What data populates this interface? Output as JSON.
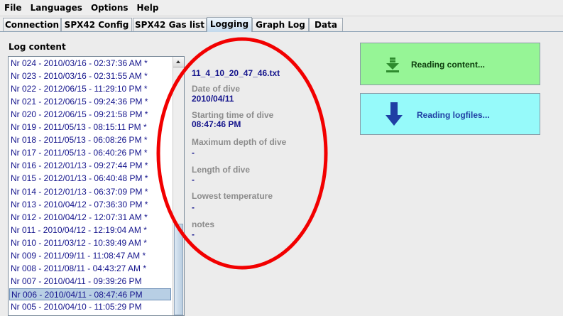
{
  "menubar": {
    "items": [
      {
        "label": "File"
      },
      {
        "label": "Languages"
      },
      {
        "label": "Options"
      },
      {
        "label": "Help"
      }
    ]
  },
  "tabs": [
    {
      "label": "Connection"
    },
    {
      "label": "SPX42 Config"
    },
    {
      "label": "SPX42 Gas list"
    },
    {
      "label": "Logging",
      "active": true
    },
    {
      "label": "Graph Log"
    },
    {
      "label": "Data"
    }
  ],
  "log": {
    "title": "Log content",
    "items": [
      "Nr  024 - 2010/03/16 - 02:37:36 AM *",
      "Nr  023 - 2010/03/16 - 02:31:55 AM *",
      "Nr  022 - 2012/06/15 - 11:29:10 PM *",
      "Nr  021 - 2012/06/15 - 09:24:36 PM *",
      "Nr  020 - 2012/06/15 - 09:21:58 PM *",
      "Nr  019 - 2011/05/13 - 08:15:11 PM *",
      "Nr  018 - 2011/05/13 - 06:08:26 PM *",
      "Nr  017 - 2011/05/13 - 06:40:26 PM *",
      "Nr  016 - 2012/01/13 - 09:27:44 PM *",
      "Nr  015 - 2012/01/13 - 06:40:48 PM *",
      "Nr  014 - 2012/01/13 - 06:37:09 PM *",
      "Nr  013 - 2010/04/12 - 07:36:30 PM *",
      "Nr  012 - 2010/04/12 - 12:07:31 AM *",
      "Nr  011 - 2010/04/12 - 12:19:04 AM *",
      "Nr  010 - 2011/03/12 - 10:39:49 AM *",
      "Nr  009 - 2011/09/11 - 11:08:47 AM *",
      "Nr  008 - 2011/08/11 - 04:43:27 AM *",
      "Nr  007 - 2010/04/11 - 09:39:26 PM",
      "Nr  006 - 2010/04/11 - 08:47:46 PM",
      "Nr  005 - 2010/04/10 - 11:05:29 PM"
    ],
    "selected_index": 18
  },
  "details": {
    "filename": "11_4_10_20_47_46.txt",
    "date_label": "Date of dive",
    "date_value": "2010/04/11",
    "start_label": "Starting time of dive",
    "start_value": "08:47:46 PM",
    "depth_label": "Maximum depth of dive",
    "depth_value": "-",
    "length_label": "Length of dive",
    "length_value": "-",
    "temp_label": "Lowest temperature",
    "temp_value": "-",
    "notes_label": "notes",
    "notes_value": "-"
  },
  "buttons": {
    "reading_content": "Reading content...",
    "reading_logfiles": "Reading logfiles..."
  },
  "colors": {
    "list_text": "#14148c",
    "content_button": "#96f596",
    "logfiles_button": "#96fafa",
    "annotation": "#f20000"
  },
  "icons": {
    "content_icon": "download-arrow-icon",
    "logfiles_icon": "down-arrow-icon"
  }
}
